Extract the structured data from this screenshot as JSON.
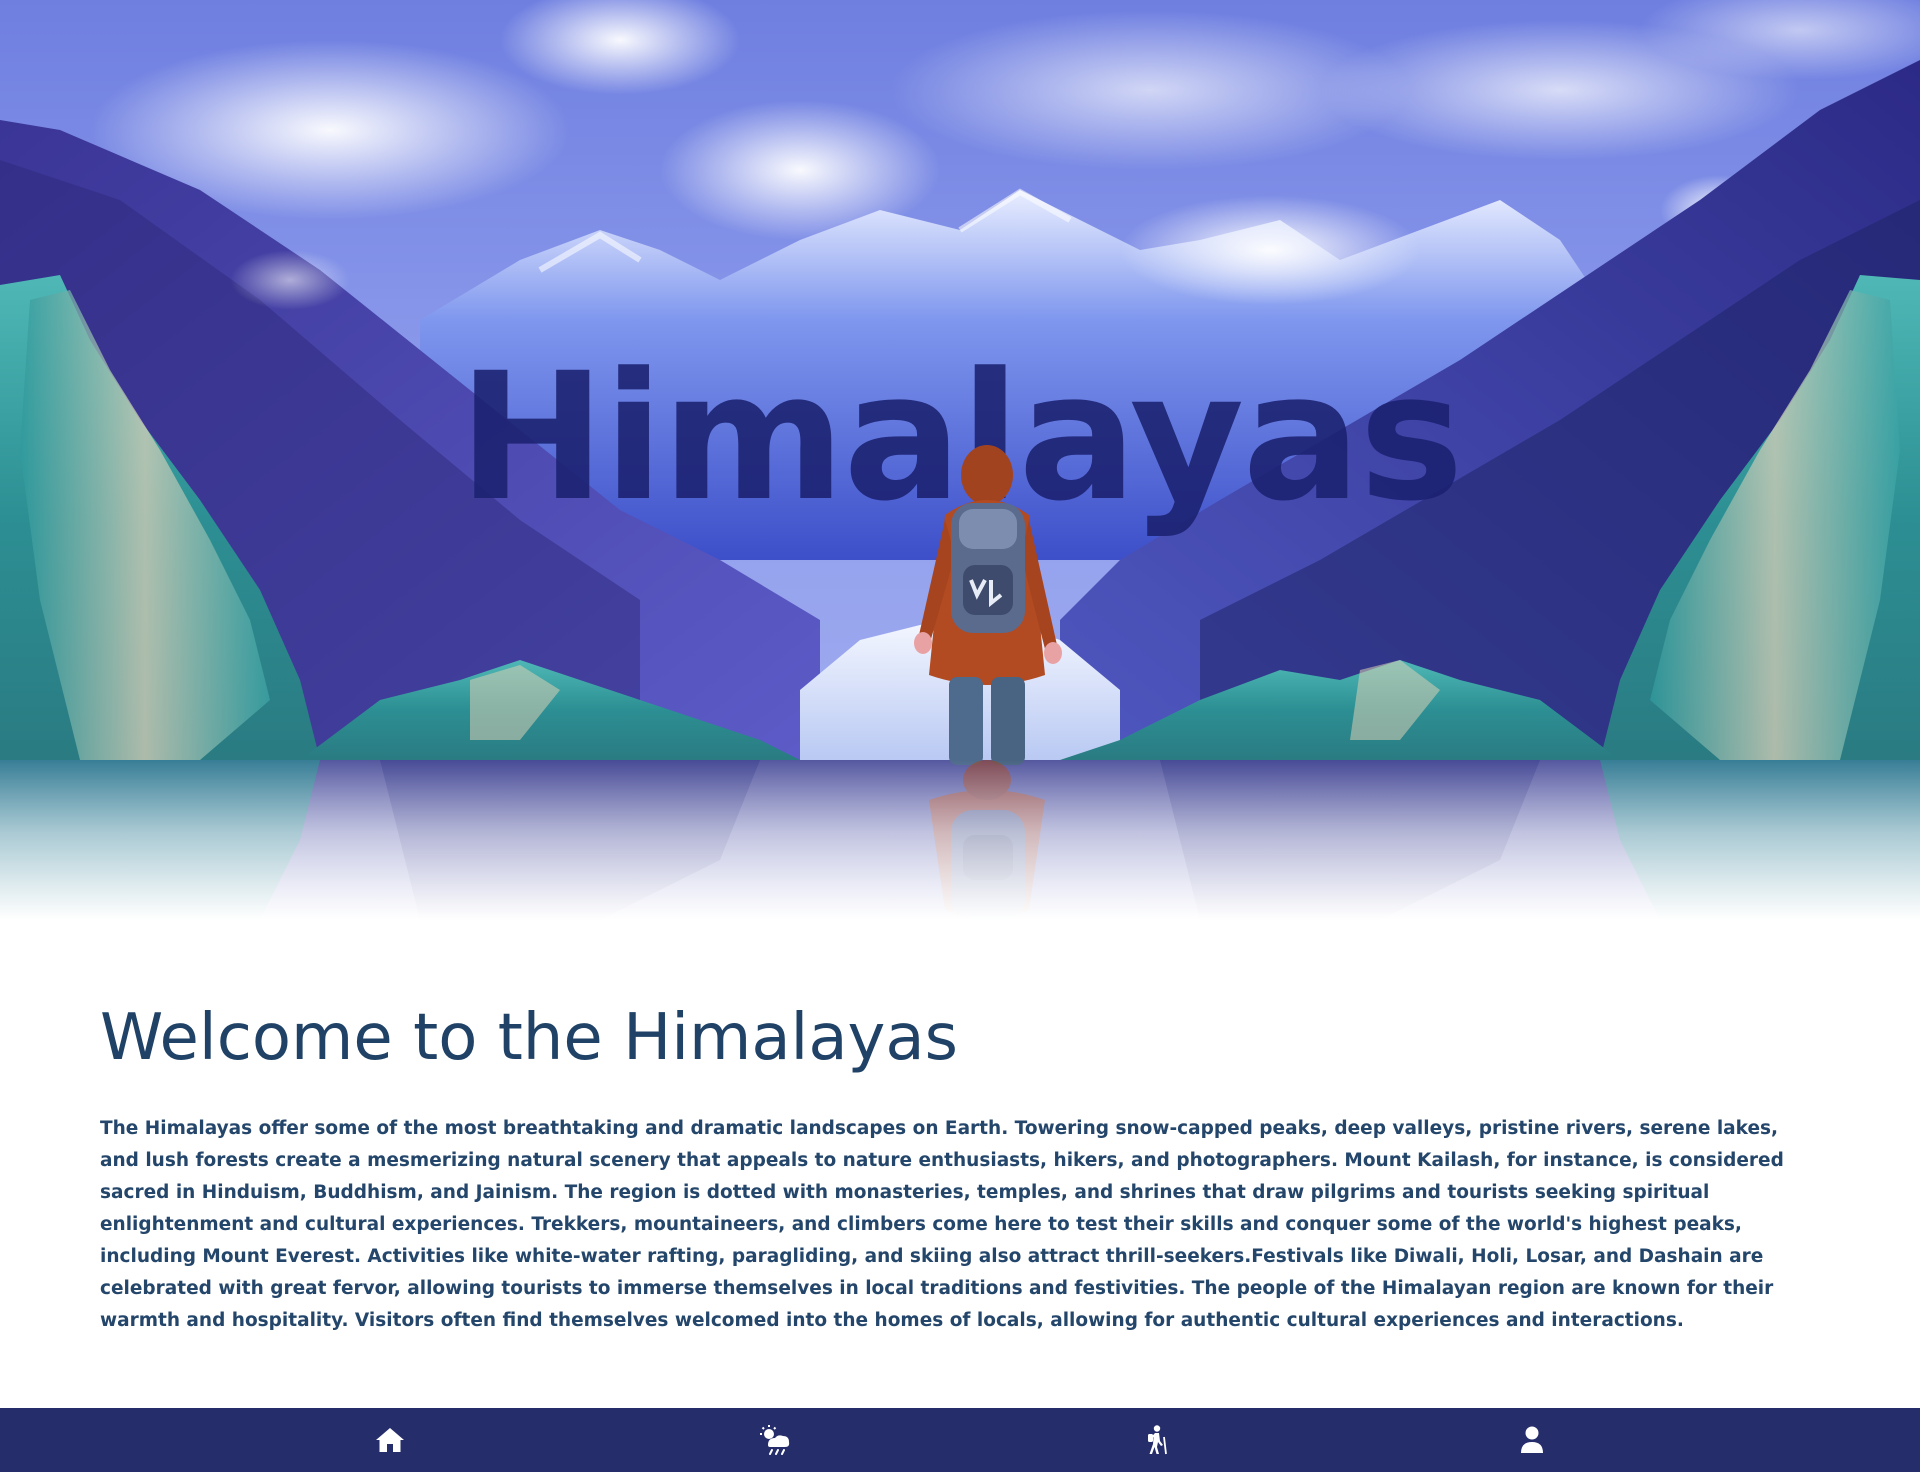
{
  "hero": {
    "title": "Himalayas"
  },
  "main": {
    "heading": "Welcome to the Himalayas",
    "body": "The Himalayas offer some of the most breathtaking and dramatic landscapes on Earth. Towering snow-capped peaks, deep valleys, pristine rivers, serene lakes, and lush forests create a mesmerizing natural scenery that appeals to nature enthusiasts, hikers, and photographers. Mount Kailash, for instance, is considered sacred in Hinduism, Buddhism, and Jainism. The region is dotted with monasteries, temples, and shrines that draw pilgrims and tourists seeking spiritual enlightenment and cultural experiences. Trekkers, mountaineers, and climbers come here to test their skills and conquer some of the world's highest peaks, including Mount Everest. Activities like white-water rafting, paragliding, and skiing also attract thrill-seekers.Festivals like Diwali, Holi, Losar, and Dashain are celebrated with great fervor, allowing tourists to immerse themselves in local traditions and festivities. The people of the Himalayan region are known for their warmth and hospitality. Visitors often find themselves welcomed into the homes of locals, allowing for authentic cultural experiences and interactions."
  },
  "bottom_nav": {
    "items": [
      {
        "icon": "home-icon"
      },
      {
        "icon": "weather-icon"
      },
      {
        "icon": "hiking-icon"
      },
      {
        "icon": "user-icon"
      }
    ]
  },
  "colors": {
    "nav_background": "#252d6b",
    "heading": "#1f4266",
    "hero_title": "#1b2170",
    "body_text": "#24466b"
  }
}
